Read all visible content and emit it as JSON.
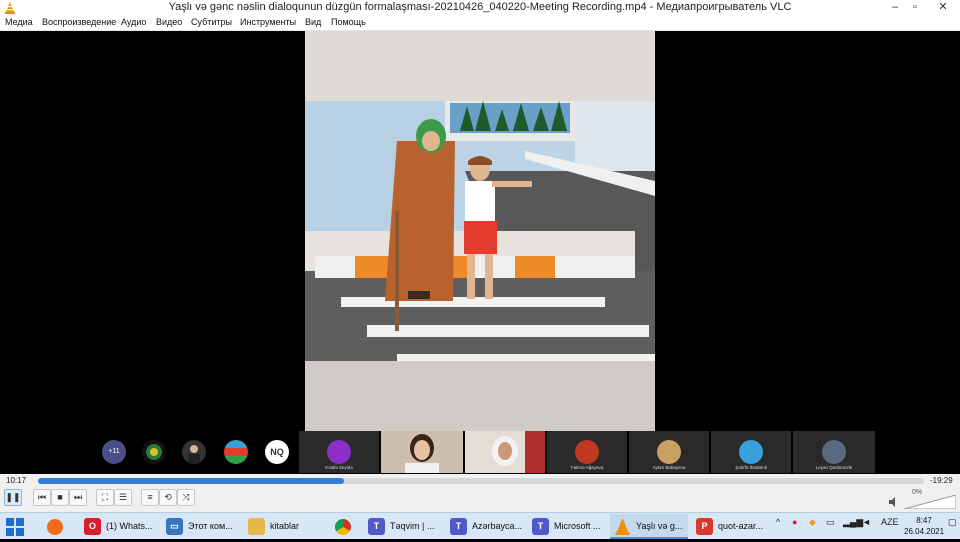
{
  "window": {
    "title": "Yaşlı və gənc nəslin dialoqunun düzgün formalaşması-20210426_040220-Meeting Recording.mp4 - Медиапроигрыватель VLC",
    "minimize": "–",
    "maximize": "▫",
    "close": "✕"
  },
  "menu": [
    "Медиа",
    "Воспроизведение",
    "Аудио",
    "Видео",
    "Субтитры",
    "Инструменты",
    "Вид",
    "Помощь"
  ],
  "participants": {
    "more_count": "+11",
    "initials": "NQ",
    "names": [
      "Kələbi Seyidə",
      "",
      "",
      "Fatimə Ağayeva",
      "Aytən Babayeva",
      "Şəhrfü İbrahimli",
      "Leyan Qədiməzde"
    ]
  },
  "player": {
    "elapsed": "10:17",
    "remaining": "-19:29",
    "progress": 0.345,
    "volume": "0%"
  },
  "controls": [
    "pause",
    "previous",
    "stop",
    "next",
    "fullscreen",
    "extended-settings",
    "playlist",
    "loop",
    "shuffle"
  ],
  "taskbar": {
    "items": [
      "(1) Whats...",
      "Этот ком...",
      "kitablar",
      "Təqvim | ...",
      "Azərbayca...",
      "Microsoft ...",
      "Yaşlı və g...",
      "quot-azar..."
    ],
    "language": "AZE",
    "time": "8:47",
    "date": "26.04.2021"
  },
  "colors": {
    "accent": "#2f7fdb",
    "taskbar": "#d7e7f5",
    "vlc_orange": "#f28c00"
  }
}
